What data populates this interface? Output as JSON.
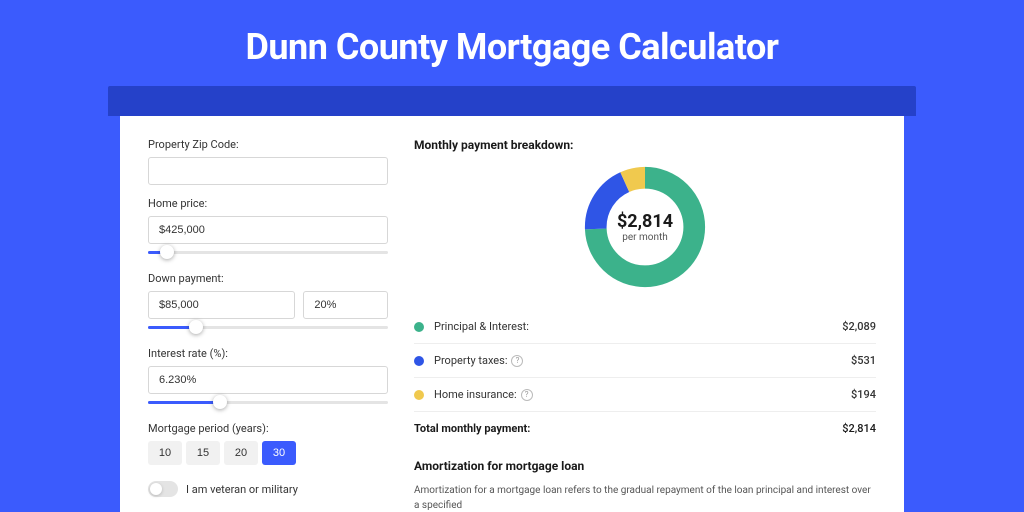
{
  "title": "Dunn County Mortgage Calculator",
  "colors": {
    "green": "#3cb28b",
    "blue": "#2f55e6",
    "yellow": "#f0c94e"
  },
  "form": {
    "zip_label": "Property Zip Code:",
    "zip_value": "",
    "home_price_label": "Home price:",
    "home_price_value": "$425,000",
    "home_price_slider_pct": 8,
    "down_payment_label": "Down payment:",
    "down_payment_value": "$85,000",
    "down_payment_pct_value": "20%",
    "down_payment_slider_pct": 20,
    "interest_label": "Interest rate (%):",
    "interest_value": "6.230%",
    "interest_slider_pct": 30,
    "period_label": "Mortgage period (years):",
    "periods": [
      "10",
      "15",
      "20",
      "30"
    ],
    "period_selected": "30",
    "veteran_label": "I am veteran or military"
  },
  "breakdown": {
    "title": "Monthly payment breakdown:",
    "center_amount": "$2,814",
    "center_sub": "per month",
    "items": [
      {
        "label": "Principal & Interest:",
        "value": "$2,089",
        "color": "green",
        "info": false
      },
      {
        "label": "Property taxes:",
        "value": "$531",
        "color": "blue",
        "info": true
      },
      {
        "label": "Home insurance:",
        "value": "$194",
        "color": "yellow",
        "info": true
      }
    ],
    "total_label": "Total monthly payment:",
    "total_value": "$2,814"
  },
  "amortization": {
    "title": "Amortization for mortgage loan",
    "text": "Amortization for a mortgage loan refers to the gradual repayment of the loan principal and interest over a specified"
  },
  "chart_data": {
    "type": "pie",
    "title": "Monthly payment breakdown",
    "series": [
      {
        "name": "Principal & Interest",
        "value": 2089,
        "color": "#3cb28b"
      },
      {
        "name": "Property taxes",
        "value": 531,
        "color": "#2f55e6"
      },
      {
        "name": "Home insurance",
        "value": 194,
        "color": "#f0c94e"
      }
    ],
    "total": 2814,
    "unit": "USD per month"
  }
}
